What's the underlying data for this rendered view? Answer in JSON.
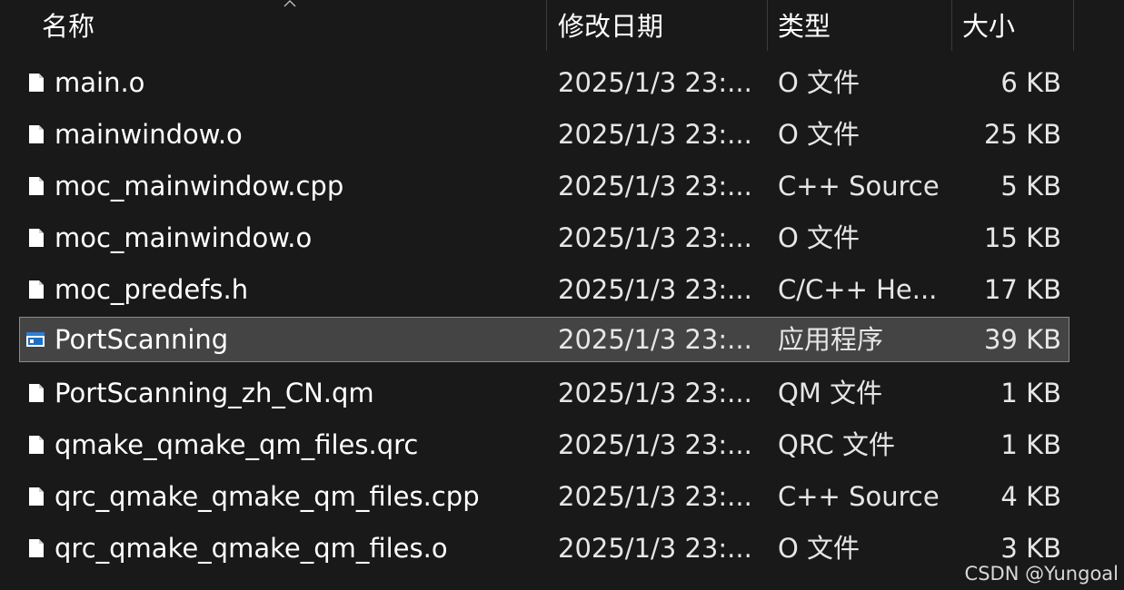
{
  "header": {
    "name": "名称",
    "date_modified": "修改日期",
    "type": "类型",
    "size": "大小"
  },
  "files": [
    {
      "name": "main.o",
      "date": "2025/1/3 23:...",
      "type": "O 文件",
      "size": "6 KB",
      "icon": "file-icon"
    },
    {
      "name": "mainwindow.o",
      "date": "2025/1/3 23:...",
      "type": "O 文件",
      "size": "25 KB",
      "icon": "file-icon"
    },
    {
      "name": "moc_mainwindow.cpp",
      "date": "2025/1/3 23:...",
      "type": "C++ Source",
      "size": "5 KB",
      "icon": "file-icon"
    },
    {
      "name": "moc_mainwindow.o",
      "date": "2025/1/3 23:...",
      "type": "O 文件",
      "size": "15 KB",
      "icon": "file-icon"
    },
    {
      "name": "moc_predefs.h",
      "date": "2025/1/3 23:...",
      "type": "C/C++ He...",
      "size": "17 KB",
      "icon": "file-icon"
    },
    {
      "name": "PortScanning",
      "date": "2025/1/3 23:...",
      "type": "应用程序",
      "size": "39 KB",
      "icon": "application-icon",
      "selected": true
    },
    {
      "name": "PortScanning_zh_CN.qm",
      "date": "2025/1/3 23:...",
      "type": "QM 文件",
      "size": "1 KB",
      "icon": "file-icon"
    },
    {
      "name": "qmake_qmake_qm_files.qrc",
      "date": "2025/1/3 23:...",
      "type": "QRC 文件",
      "size": "1 KB",
      "icon": "file-icon"
    },
    {
      "name": "qrc_qmake_qmake_qm_files.cpp",
      "date": "2025/1/3 23:...",
      "type": "C++ Source",
      "size": "4 KB",
      "icon": "file-icon"
    },
    {
      "name": "qrc_qmake_qmake_qm_files.o",
      "date": "2025/1/3 23:...",
      "type": "O 文件",
      "size": "3 KB",
      "icon": "file-icon"
    }
  ],
  "watermark": "CSDN @Yungoal",
  "colors": {
    "background": "#191919",
    "selected_row": "#444444",
    "selected_border": "#8a8a8a",
    "text": "#ffffff"
  }
}
